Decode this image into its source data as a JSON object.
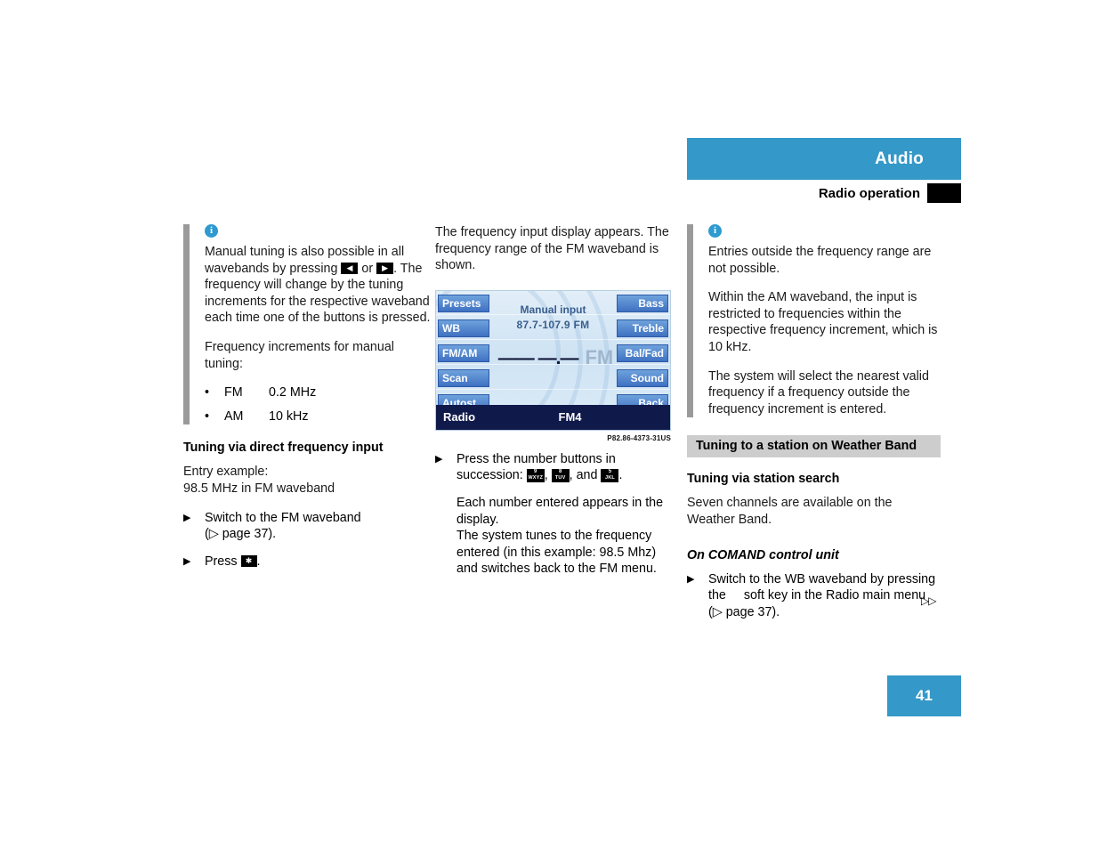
{
  "header": {
    "title": "Audio",
    "subtitle": "Radio operation",
    "accent_color": "#3498c8"
  },
  "left_column": {
    "note": {
      "icon": "info-icon",
      "paragraph1": "Manual tuning is also possible in all wavebands by pressing",
      "paragraph1_mid": "or",
      "paragraph1_end": ".",
      "paragraph2": "The frequency will change by the tuning increments for the respective waveband each time one of the buttons is pressed.",
      "paragraph3": "Frequency increments for manual tuning:",
      "bullets": [
        {
          "dot": "•",
          "band": "FM",
          "increment": "0.2 MHz"
        },
        {
          "dot": "•",
          "band": "AM",
          "increment": "10 kHz"
        }
      ],
      "key_left": "◀",
      "key_right": "▶"
    },
    "heading": "Tuning via direct frequency input",
    "entry_example_label": "Entry example:",
    "entry_example_value": "98.5 MHz in FM waveband",
    "steps": [
      {
        "marker": "▶",
        "text": "Switch to the FM waveband",
        "text2": "(▷ page 37)."
      },
      {
        "marker": "▶",
        "text_before": "Press",
        "key": "✱",
        "text_after": "."
      }
    ]
  },
  "middle_column": {
    "intro": "The frequency input display appears. The frequency range of the FM waveband is shown.",
    "radio_display": {
      "left_softkeys": [
        "Presets",
        "WB",
        "FM/AM",
        "Scan",
        "Autost."
      ],
      "right_softkeys": [
        "Bass",
        "Treble",
        "Bal/Fad",
        "Sound",
        "Back"
      ],
      "center_line1": "Manual input",
      "center_line2": "87.7-107.9 FM",
      "frequency_placeholder": "—— —.—",
      "frequency_band": "FM",
      "status_left": "Radio",
      "status_center": "FM4"
    },
    "figure_caption": "P82.86-4373-31US",
    "step": {
      "marker": "▶",
      "text_before": "Press the number buttons in succession:",
      "keys": [
        {
          "number": "9",
          "letters": "WXYZ"
        },
        {
          "number": "8",
          "letters": "TUV"
        },
        {
          "number": "5",
          "letters": "JKL"
        }
      ],
      "separator1": ",",
      "separator2": ", and",
      "text_after": "."
    },
    "paragraph": "Each number entered appears in the display.",
    "paragraph2": "The system tunes to the frequency entered (in this example: 98.5 Mhz) and switches back to the FM menu."
  },
  "right_column": {
    "note": {
      "icon": "info-icon",
      "paragraph1": "Entries outside the frequency range are not possible.",
      "paragraph2": "Within the AM waveband, the input is restricted to frequencies within the respective frequency increment, which is 10 kHz.",
      "paragraph3": "The system will select the nearest valid frequency if a frequency outside the frequency increment is entered."
    },
    "section_heading": "Tuning to a station on Weather Band",
    "subheading": "Tuning via station search",
    "paragraph": "Seven channels are available on the Weather Band.",
    "italic_heading": "On COMAND control unit",
    "step": {
      "marker": "▶",
      "text_before": "Switch to the WB waveband by pressing the",
      "text_after": "soft key in the Radio main menu (▷ page 37)."
    },
    "continuation": "▷▷"
  },
  "footer": {
    "page_number": "41"
  }
}
